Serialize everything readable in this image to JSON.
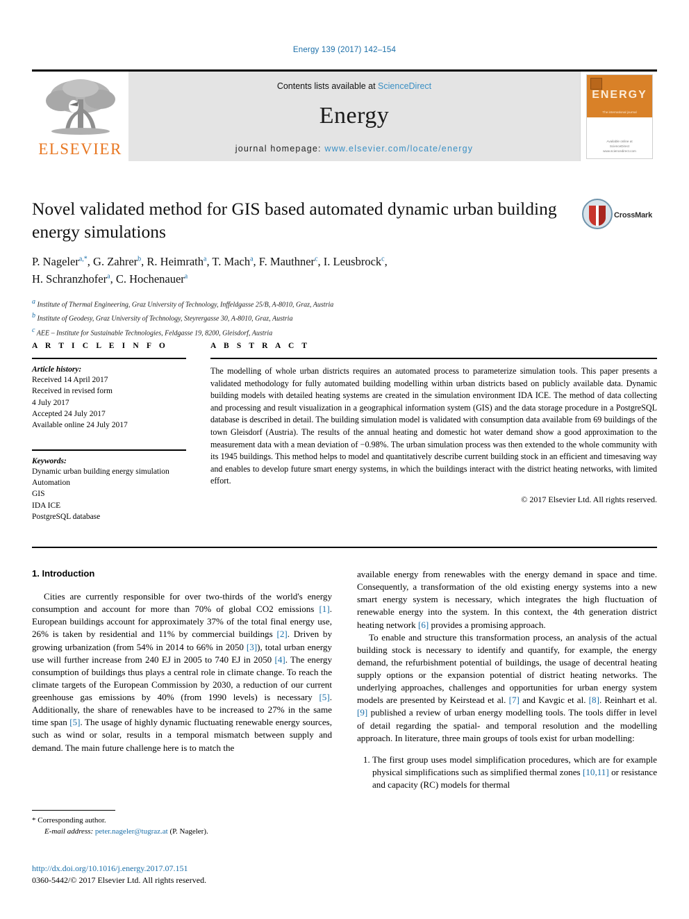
{
  "running_head": "Energy 139 (2017) 142–154",
  "banner": {
    "publisher_name": "ELSEVIER",
    "contents_prefix": "Contents lists available at ",
    "contents_link": "ScienceDirect",
    "journal_name": "Energy",
    "homepage_label": "journal homepage: ",
    "homepage_url": "www.elsevier.com/locate/energy",
    "cover": {
      "title": "ENERGY",
      "tagline": "The international journal",
      "footer_line1": "Available online at",
      "footer_line2": "ScienceDirect",
      "footer_line3": "www.sciencedirect.com"
    }
  },
  "article": {
    "title": "Novel validated method for GIS based automated dynamic urban building energy simulations",
    "authors_line1": "P. Nageler a,*, G. Zahrer b, R. Heimrath a, T. Mach a, F. Mauthner c, I. Leusbrock c,",
    "authors_line2": "H. Schranzhofer a, C. Hochenauer a",
    "authors": [
      {
        "name": "P. Nageler",
        "marks": "a,*"
      },
      {
        "name": "G. Zahrer",
        "marks": "b"
      },
      {
        "name": "R. Heimrath",
        "marks": "a"
      },
      {
        "name": "T. Mach",
        "marks": "a"
      },
      {
        "name": "F. Mauthner",
        "marks": "c"
      },
      {
        "name": "I. Leusbrock",
        "marks": "c"
      },
      {
        "name": "H. Schranzhofer",
        "marks": "a"
      },
      {
        "name": "C. Hochenauer",
        "marks": "a"
      }
    ],
    "affiliations": [
      {
        "mark": "a",
        "text": "Institute of Thermal Engineering, Graz University of Technology, Inffeldgasse 25/B, A-8010, Graz, Austria"
      },
      {
        "mark": "b",
        "text": "Institute of Geodesy, Graz University of Technology, Steyrergasse 30, A-8010, Graz, Austria"
      },
      {
        "mark": "c",
        "text": "AEE – Institute for Sustainable Technologies, Feldgasse 19, 8200, Gleisdorf, Austria"
      }
    ],
    "crossmark_label": "CrossMark"
  },
  "article_info": {
    "heading": "A R T I C L E   I N F O",
    "history_label": "Article history:",
    "history": [
      "Received 14 April 2017",
      "Received in revised form",
      "4 July 2017",
      "Accepted 24 July 2017",
      "Available online 24 July 2017"
    ],
    "keywords_label": "Keywords:",
    "keywords": [
      "Dynamic urban building energy simulation",
      "Automation",
      "GIS",
      "IDA ICE",
      "PostgreSQL database"
    ]
  },
  "abstract": {
    "heading": "A B S T R A C T",
    "text": "The modelling of whole urban districts requires an automated process to parameterize simulation tools. This paper presents a validated methodology for fully automated building modelling within urban districts based on publicly available data. Dynamic building models with detailed heating systems are created in the simulation environment IDA ICE. The method of data collecting and processing and result visualization in a geographical information system (GIS) and the data storage procedure in a PostgreSQL database is described in detail. The building simulation model is validated with consumption data available from 69 buildings of the town Gleisdorf (Austria). The results of the annual heating and domestic hot water demand show a good approximation to the measurement data with a mean deviation of −0.98%. The urban simulation process was then extended to the whole community with its 1945 buildings. This method helps to model and quantitatively describe current building stock in an efficient and timesaving way and enables to develop future smart energy systems, in which the buildings interact with the district heating networks, with limited effort.",
    "copyright": "© 2017 Elsevier Ltd. All rights reserved."
  },
  "introduction": {
    "heading": "1. Introduction",
    "left_para1_a": "Cities are currently responsible for over two-thirds of the world's energy consumption and account for more than 70% of global CO2 emissions ",
    "left_ref1": "[1]",
    "left_para1_b": ". European buildings account for approximately 37% of the total final energy use, 26% is taken by residential and 11% by commercial buildings ",
    "left_ref2": "[2]",
    "left_para1_c": ". Driven by growing urbanization (from 54% in 2014 to 66% in 2050 ",
    "left_ref3": "[3]",
    "left_para1_d": "), total urban energy use will further increase from 240 EJ in 2005 to 740 EJ in 2050 ",
    "left_ref4": "[4]",
    "left_para1_e": ". The energy consumption of buildings thus plays a central role in climate change. To reach the climate targets of the European Commission by 2030, a reduction of our current greenhouse gas emissions by 40% (from 1990 levels) is necessary ",
    "left_ref5": "[5]",
    "left_para1_f": ". Additionally, the share of renewables have to be increased to 27% in the same time span ",
    "left_ref6": "[5]",
    "left_para1_g": ". The usage of highly dynamic fluctuating renewable energy sources, such as wind or solar, results in a temporal mismatch between supply and demand. The main future challenge here is to match the",
    "right_para1_a": "available energy from renewables with the energy demand in space and time. Consequently, a transformation of the old existing energy systems into a new smart energy system is necessary, which integrates the high fluctuation of renewable energy into the system. In this context, the 4th generation district heating network ",
    "right_ref6": "[6]",
    "right_para1_b": " provides a promising approach.",
    "right_para2_a": "To enable and structure this transformation process, an analysis of the actual building stock is necessary to identify and quantify, for example, the energy demand, the refurbishment potential of buildings, the usage of decentral heating supply options or the expansion potential of district heating networks. The underlying approaches, challenges and opportunities for urban energy system models are presented by Keirstead et al. ",
    "right_ref7": "[7]",
    "right_para2_b": " and Kavgic et al. ",
    "right_ref8": "[8]",
    "right_para2_c": ". Reinhart et al. ",
    "right_ref9": "[9]",
    "right_para2_d": " published a review of urban energy modelling tools. The tools differ in level of detail regarding the spatial- and temporal resolution and the modelling approach. In literature, three main groups of tools exist for urban modelling:",
    "list_item1_a": "The first group uses model simplification procedures, which are for example physical simplifications such as simplified thermal zones ",
    "list_item1_ref": "[10,11]",
    "list_item1_b": " or resistance and capacity (RC) models for thermal"
  },
  "footer": {
    "corresponding_marker": "*",
    "corresponding_label": " Corresponding author.",
    "email_label": "E-mail address: ",
    "email": "peter.nageler@tugraz.at",
    "email_suffix": " (P. Nageler).",
    "doi": "http://dx.doi.org/10.1016/j.energy.2017.07.151",
    "issn_line": "0360-5442/© 2017 Elsevier Ltd. All rights reserved."
  },
  "colors": {
    "link_blue": "#1a6ea8",
    "elsevier_orange": "#E87722",
    "banner_grey": "#e4e4e4",
    "cover_orange": "#d98128"
  }
}
